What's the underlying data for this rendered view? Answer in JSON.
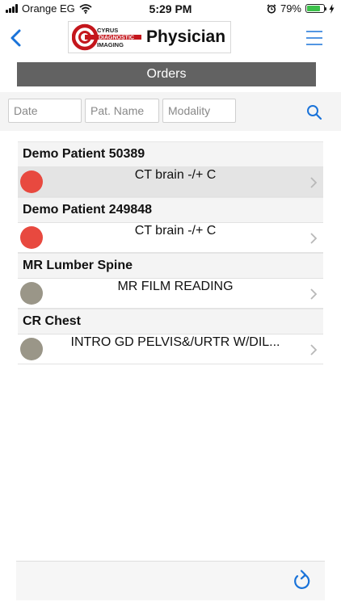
{
  "status_bar": {
    "carrier": "Orange EG",
    "time": "5:29 PM",
    "battery_percent": "79%",
    "battery_level": 0.79
  },
  "header": {
    "logo_text_line1": "CYRUS",
    "logo_text_line2": "DIAGNOSTIC",
    "logo_text_line3": "IMAGING",
    "app_title": "Physician"
  },
  "title_bar": {
    "title": "Orders"
  },
  "filters": {
    "date_placeholder": "Date",
    "patient_name_placeholder": "Pat. Name",
    "modality_placeholder": "Modality"
  },
  "orders": [
    {
      "patient": "Demo Patient 50389",
      "procedure": "CT brain -/+ C",
      "status_color": "#e8493f",
      "selected": true
    },
    {
      "patient": "Demo Patient 249848",
      "procedure": "CT brain -/+ C",
      "status_color": "#e8493f",
      "selected": false
    },
    {
      "patient": "MR Lumber Spine",
      "procedure": "MR FILM READING",
      "status_color": "#9a9688",
      "selected": false
    },
    {
      "patient": "CR Chest",
      "procedure": "INTRO GD PELVIS&/URTR W/DIL...",
      "status_color": "#9a9688",
      "selected": false
    }
  ],
  "colors": {
    "accent": "#1a73d9",
    "title_bar_bg": "#626262",
    "logo_red": "#c4161c"
  },
  "icons": {
    "back": "chevron-left-icon",
    "menu": "hamburger-menu-icon",
    "search": "search-icon",
    "refresh": "refresh-icon",
    "row_chevron": "chevron-right-icon",
    "alarm": "alarm-icon",
    "wifi": "wifi-icon",
    "charging": "charging-bolt-icon"
  }
}
